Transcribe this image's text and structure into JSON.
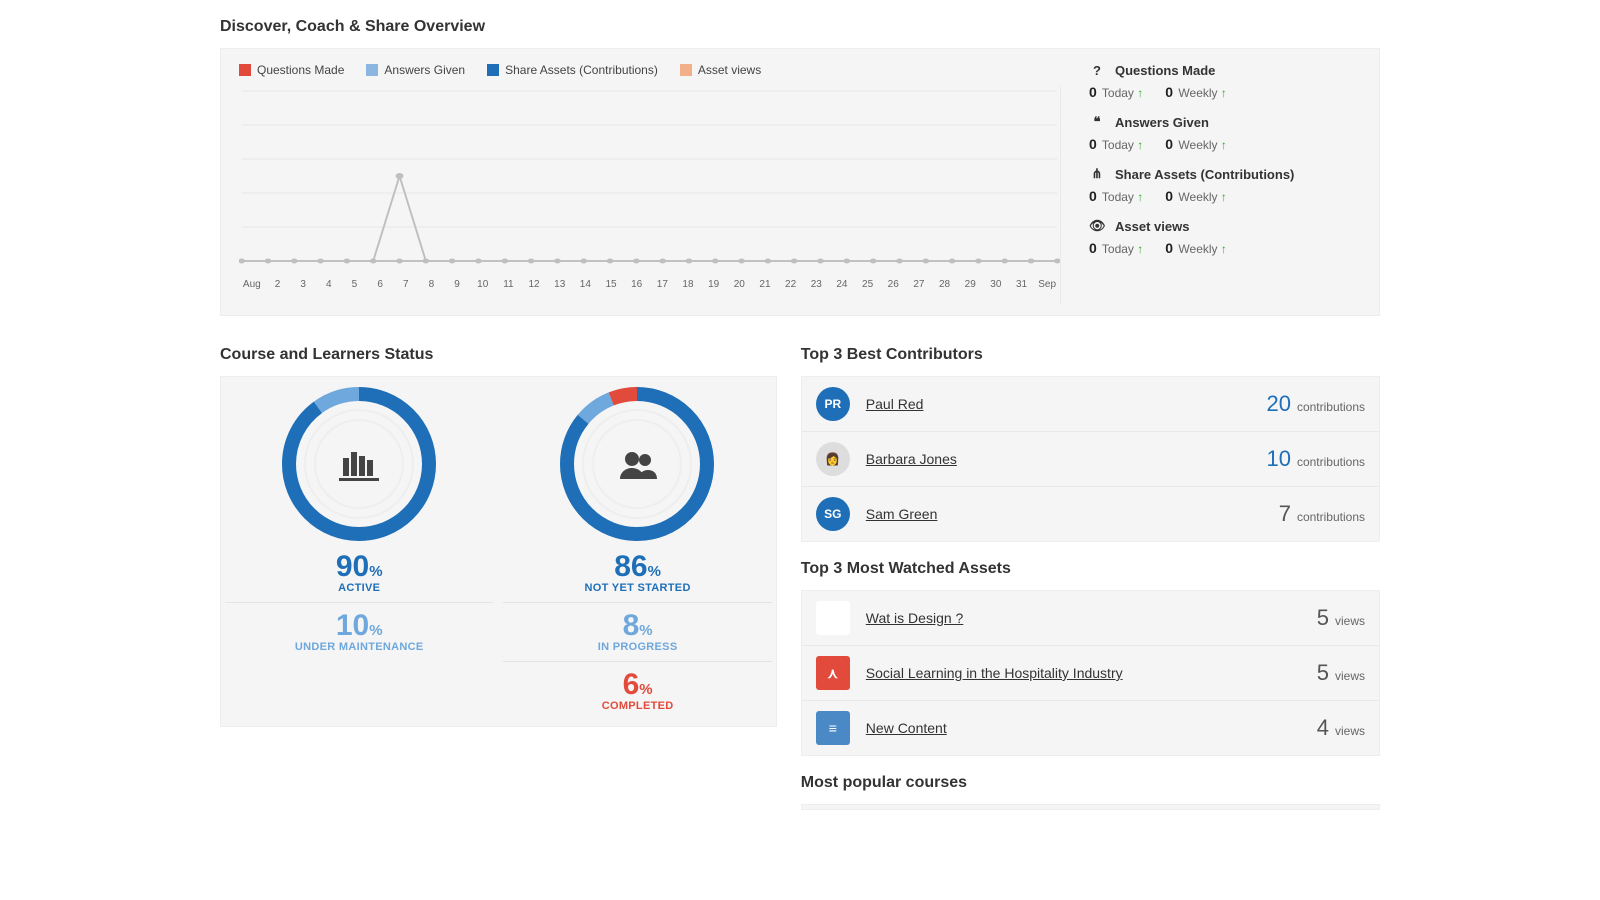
{
  "colors": {
    "red": "#e24a3b",
    "blueLight": "#8ab6e0",
    "blueDark": "#1e6fb8",
    "orange": "#f2b08a",
    "grey": "#bfbfbf",
    "panelGrey": "#e0e0e0"
  },
  "overview": {
    "title": "Discover, Coach & Share Overview",
    "legend": [
      {
        "label": "Questions Made",
        "colorKey": "red"
      },
      {
        "label": "Answers Given",
        "colorKey": "blueLight"
      },
      {
        "label": "Share Assets (Contributions)",
        "colorKey": "blueDark"
      },
      {
        "label": "Asset views",
        "colorKey": "orange"
      }
    ],
    "stats": [
      {
        "icon": "question-icon",
        "glyph": "?",
        "label": "Questions Made",
        "today": "0",
        "weekly": "0"
      },
      {
        "icon": "quote-icon",
        "glyph": "❝",
        "label": "Answers Given",
        "today": "0",
        "weekly": "0"
      },
      {
        "icon": "share-icon",
        "glyph": "⋔",
        "label": "Share Assets (Contributions)",
        "today": "0",
        "weekly": "0"
      },
      {
        "icon": "eye-icon",
        "glyph": "👁",
        "label": "Asset views",
        "today": "0",
        "weekly": "0"
      }
    ],
    "stat_labels": {
      "today": "Today",
      "weekly": "Weekly"
    }
  },
  "chart_data": {
    "type": "line",
    "title": "Discover, Coach & Share Overview",
    "xlabel": "",
    "ylabel": "",
    "x_ticks": [
      "Aug",
      "2",
      "3",
      "4",
      "5",
      "6",
      "7",
      "8",
      "9",
      "10",
      "11",
      "12",
      "13",
      "14",
      "15",
      "16",
      "17",
      "18",
      "19",
      "20",
      "21",
      "22",
      "23",
      "24",
      "25",
      "26",
      "27",
      "28",
      "29",
      "30",
      "31",
      "Sep"
    ],
    "ylim": [
      0,
      10
    ],
    "grid": true,
    "series": [
      {
        "name": "Questions Made",
        "color": "#e24a3b",
        "values": [
          0,
          0,
          0,
          0,
          0,
          0,
          0,
          0,
          0,
          0,
          0,
          0,
          0,
          0,
          0,
          0,
          0,
          0,
          0,
          0,
          0,
          0,
          0,
          0,
          0,
          0,
          0,
          0,
          0,
          0,
          0,
          0
        ]
      },
      {
        "name": "Answers Given",
        "color": "#8ab6e0",
        "values": [
          0,
          0,
          0,
          0,
          0,
          0,
          0,
          0,
          0,
          0,
          0,
          0,
          0,
          0,
          0,
          0,
          0,
          0,
          0,
          0,
          0,
          0,
          0,
          0,
          0,
          0,
          0,
          0,
          0,
          0,
          0,
          0
        ]
      },
      {
        "name": "Share Assets (Contributions)",
        "color": "#1e6fb8",
        "values": [
          0,
          0,
          0,
          0,
          0,
          0,
          0,
          0,
          0,
          0,
          0,
          0,
          0,
          0,
          0,
          0,
          0,
          0,
          0,
          0,
          0,
          0,
          0,
          0,
          0,
          0,
          0,
          0,
          0,
          0,
          0,
          0
        ]
      },
      {
        "name": "Asset views",
        "color": "#f2b08a",
        "values": [
          0,
          0,
          0,
          0,
          0,
          0,
          5,
          0,
          0,
          0,
          0,
          0,
          0,
          0,
          0,
          0,
          0,
          0,
          0,
          0,
          0,
          0,
          0,
          0,
          0,
          0,
          0,
          0,
          0,
          0,
          0,
          0
        ]
      }
    ]
  },
  "course_status": {
    "title": "Course and Learners Status",
    "courses": {
      "icon": "library-icon",
      "segments": [
        {
          "label": "ACTIVE",
          "pct": 90,
          "colorClass": "c-blue"
        },
        {
          "label": "UNDER MAINTENANCE",
          "pct": 10,
          "colorClass": "c-blue2"
        }
      ]
    },
    "learners": {
      "icon": "people-icon",
      "segments": [
        {
          "label": "NOT YET STARTED",
          "pct": 86,
          "colorClass": "c-blue"
        },
        {
          "label": "IN PROGRESS",
          "pct": 8,
          "colorClass": "c-blue2"
        },
        {
          "label": "COMPLETED",
          "pct": 6,
          "colorClass": "c-red"
        }
      ]
    }
  },
  "contributors": {
    "title": "Top 3 Best Contributors",
    "unit": "contributions",
    "rows": [
      {
        "initials": "PR",
        "bg": "#1e6fb8",
        "name": "Paul Red",
        "count": 20,
        "numClass": ""
      },
      {
        "initials": "",
        "bg": "#ddd",
        "img": true,
        "name": "Barbara Jones",
        "count": 10,
        "numClass": ""
      },
      {
        "initials": "SG",
        "bg": "#1e6fb8",
        "name": "Sam Green",
        "count": 7,
        "numClass": "g"
      }
    ]
  },
  "watched": {
    "title": "Top 3 Most Watched Assets",
    "unit": "views",
    "rows": [
      {
        "thumbBg": "#fff",
        "glyph": "",
        "name": "Wat is Design ?",
        "count": 5
      },
      {
        "thumbBg": "#e24a3b",
        "glyph": "⋏",
        "name": "Social Learning in the Hospitality Industry",
        "count": 5
      },
      {
        "thumbBg": "#4a88c6",
        "glyph": "≡",
        "name": "New Content",
        "count": 4
      }
    ]
  },
  "popular": {
    "title": "Most popular courses"
  }
}
